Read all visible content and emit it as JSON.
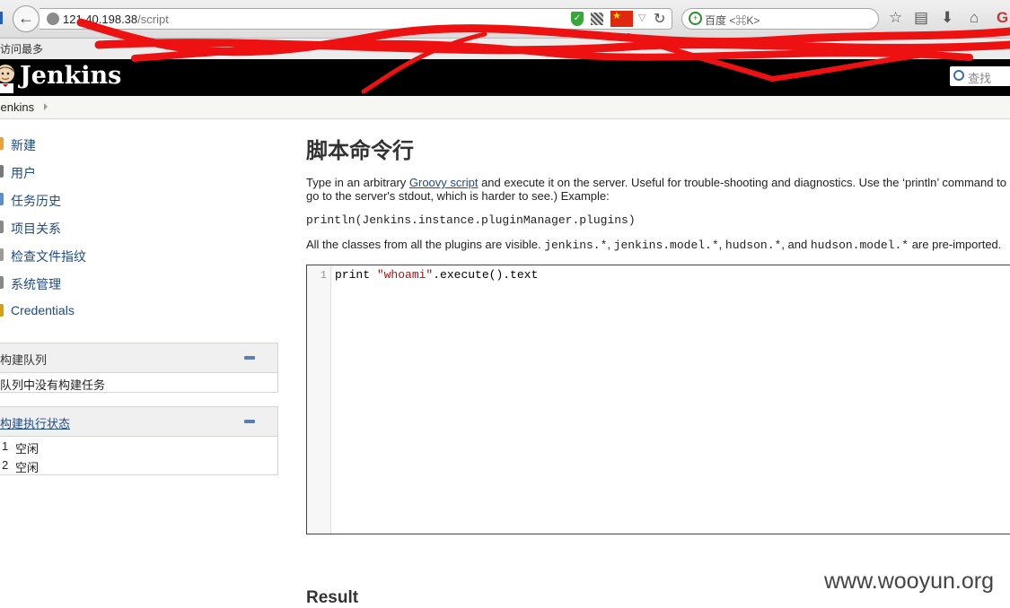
{
  "browser": {
    "url_host": "121.40.198.38",
    "url_path": "/script",
    "search_placeholder": "百度 <⌘K>",
    "bookmark_label": "访问最多",
    "icons": [
      "back-arrow-icon",
      "globe-icon",
      "shield-icon",
      "qr-code-icon",
      "china-flag-icon",
      "dropdown-icon",
      "reload-icon",
      "search-engine-icon",
      "star-icon",
      "reading-list-icon",
      "download-icon",
      "home-icon"
    ]
  },
  "header": {
    "title": "Jenkins",
    "search_placeholder": "查找"
  },
  "breadcrumb": {
    "item": "Jenkins"
  },
  "sidebar": {
    "tasks": [
      {
        "label": "新建",
        "icon": "new-item-icon",
        "color": "#e8a33c"
      },
      {
        "label": "用户",
        "icon": "people-icon",
        "color": "#7a7a7a"
      },
      {
        "label": "任务历史",
        "icon": "history-icon",
        "color": "#5a8fc8"
      },
      {
        "label": "项目关系",
        "icon": "search-icon",
        "color": "#888888"
      },
      {
        "label": "检查文件指纹",
        "icon": "fingerprint-icon",
        "color": "#9a9a9a"
      },
      {
        "label": "系统管理",
        "icon": "wrench-icon",
        "color": "#888888"
      },
      {
        "label": "Credentials",
        "icon": "key-icon",
        "color": "#d4a017"
      }
    ],
    "queue": {
      "title": "构建队列",
      "empty_text": "队列中没有构建任务"
    },
    "executors": {
      "title": "构建执行状态",
      "rows": [
        {
          "num": "1",
          "status": "空闲"
        },
        {
          "num": "2",
          "status": "空闲"
        }
      ]
    }
  },
  "main": {
    "title": "脚本命令行",
    "desc_before_link": "Type in an arbitrary ",
    "desc_link": "Groovy script",
    "desc_after_link": " and execute it on the server. Useful for trouble-shooting and diagnostics. Use the ‘println’ command to s",
    "desc_line2": "go to the server's stdout, which is harder to see.) Example:",
    "example_code": "println(Jenkins.instance.pluginManager.plugins)",
    "classes_prefix": "All the classes from all the plugins are visible. ",
    "classes_pkg1": "jenkins.*",
    "classes_sep1": ", ",
    "classes_pkg2": "jenkins.model.*",
    "classes_sep2": ", ",
    "classes_pkg3": "hudson.*",
    "classes_sep3": ", and ",
    "classes_pkg4": "hudson.model.*",
    "classes_suffix": " are pre-imported.",
    "editor": {
      "line_number": "1",
      "code_pre": "print ",
      "code_string": "\"whoami\"",
      "code_post": ".execute().text"
    },
    "result_title": "Result"
  },
  "watermark": "www.wooyun.org",
  "colors": {
    "header_bg": "#000000",
    "link": "#204a87",
    "scribble": "#ee1111"
  }
}
